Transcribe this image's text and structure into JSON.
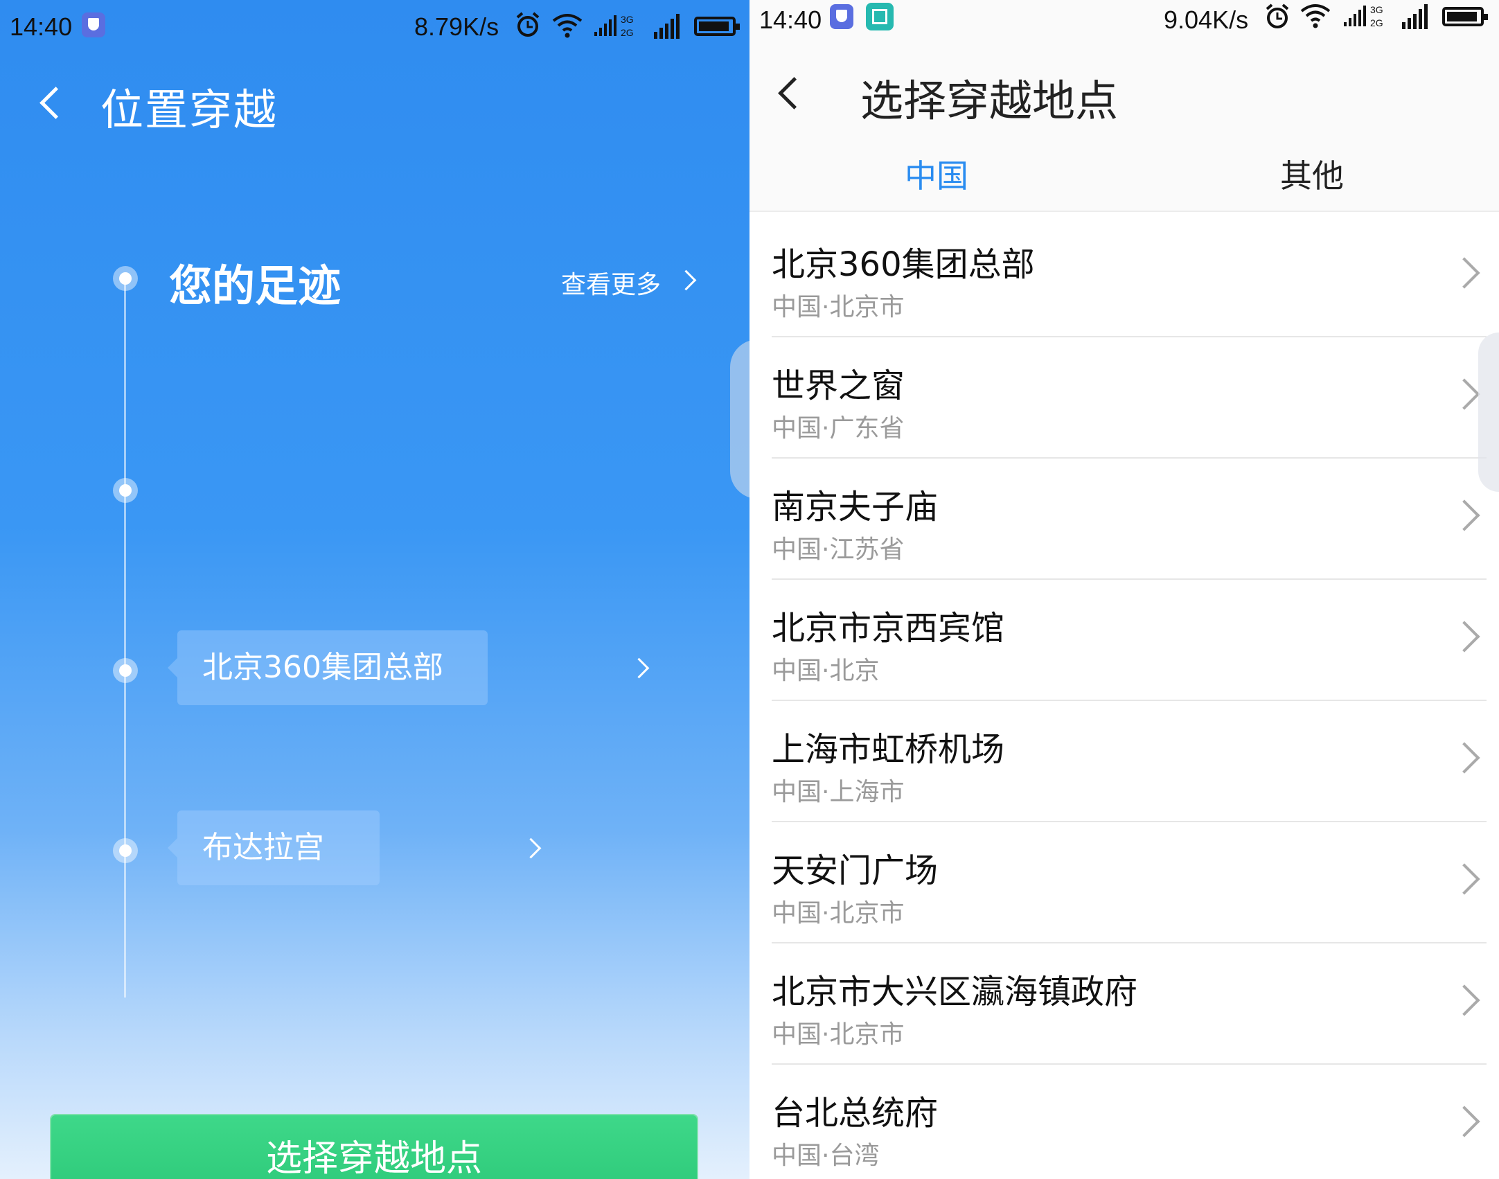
{
  "left": {
    "status_bar": {
      "time": "14:40",
      "speed": "8.79K/s"
    },
    "title": "位置穿越",
    "footprints": {
      "heading": "您的足迹",
      "more_label": "查看更多",
      "items": [
        {
          "label": "北京360集团总部"
        },
        {
          "label": "布达拉宫"
        }
      ]
    },
    "cta_label": "选择穿越地点"
  },
  "right": {
    "status_bar": {
      "time": "14:40",
      "speed": "9.04K/s"
    },
    "title": "选择穿越地点",
    "tabs": [
      {
        "label": "中国",
        "active": true
      },
      {
        "label": "其他",
        "active": false
      }
    ],
    "places": [
      {
        "name": "北京360集团总部",
        "address": "中国·北京市"
      },
      {
        "name": "世界之窗",
        "address": "中国·广东省"
      },
      {
        "name": "南京夫子庙",
        "address": "中国·江苏省"
      },
      {
        "name": "北京市京西宾馆",
        "address": "中国·北京"
      },
      {
        "name": "上海市虹桥机场",
        "address": "中国·上海市"
      },
      {
        "name": "天安门广场",
        "address": "中国·北京市"
      },
      {
        "name": "北京市大兴区瀛海镇政府",
        "address": "中国·北京市"
      },
      {
        "name": "台北总统府",
        "address": "中国·台湾"
      }
    ]
  },
  "colors": {
    "accent": "#2a8cf0",
    "cta": "#33cf7e",
    "header_blue": "#2f8cf0"
  }
}
